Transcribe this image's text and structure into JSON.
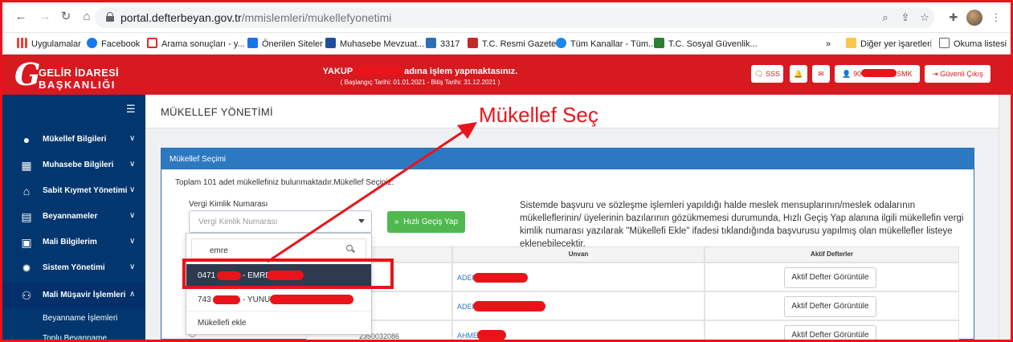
{
  "browser": {
    "url_host": "portal.defterbeyan.gov.tr",
    "url_path": "/mmislemleri/mukellefyonetimi",
    "bookmarks": [
      {
        "label": "Uygulamalar",
        "color": "#ea4335"
      },
      {
        "label": "Facebook",
        "color": "#1877f2"
      },
      {
        "label": "Arama sonuçları - y...",
        "color": "#d93025"
      },
      {
        "label": "Önerilen Siteler",
        "color": "#1a73e8"
      },
      {
        "label": "Muhasebe Mevzuat...",
        "color": "#1f4e9d"
      },
      {
        "label": "3317",
        "color": "#2f6db5"
      },
      {
        "label": "T.C. Resmi Gazete",
        "color": "#c62828"
      },
      {
        "label": "Tüm Kanallar - Tüm...",
        "color": "#1e88e5"
      },
      {
        "label": "T.C. Sosyal Güvenlik...",
        "color": "#2e7d32"
      }
    ],
    "more_label": "»",
    "other_bookmarks": "Diğer yer işaretleri",
    "reading_list": "Okuma listesi"
  },
  "header": {
    "logo_line1": "GELİR İDARESİ",
    "logo_line2": "BAŞKANLIĞI",
    "user_prefix": "YAKUP",
    "user_suffix": "adına işlem yapmaktasınız.",
    "period": "( Başlangıç Tarihi: 01.01.2021 - Bitiş Tarihi: 31.12.2021 )",
    "sss_label": "SSS",
    "user_id_prefix": "90",
    "user_id_suffix": "SMK",
    "logout_label": "Güvenli Çıkış"
  },
  "sidebar": {
    "items": [
      {
        "label": "Mükellef Bilgileri",
        "icon": "user-icon"
      },
      {
        "label": "Muhasebe Bilgileri",
        "icon": "calculator-icon"
      },
      {
        "label": "Sabit Kıymet Yönetimi",
        "icon": "home-icon"
      },
      {
        "label": "Beyannameler",
        "icon": "document-icon"
      },
      {
        "label": "Mali Bilgilerim",
        "icon": "briefcase-icon"
      },
      {
        "label": "Sistem Yönetimi",
        "icon": "gear-icon"
      },
      {
        "label": "Mali Müşavir İşlemleri",
        "icon": "users-icon"
      }
    ],
    "sub_items": [
      "Beyanname İşlemleri",
      "Toplu Beyanname"
    ]
  },
  "main": {
    "page_title": "MÜKELLEF YÖNETİMİ",
    "panel_title": "Mükellef Seçimi",
    "info_line": "Toplam 101 adet mükellefiniz bulunmaktadır.Mükellef Seçiniz:",
    "vkn_label": "Vergi Kimlik Numarası",
    "vkn_placeholder": "Vergi Kimlik Numarası",
    "quick_button": "Hızlı Geçiş Yap",
    "notice": "Sistemde başvuru ve sözleşme işlemleri yapıldığı halde meslek mensuplarının/meslek odalarının mükelleflerinin/ üyelerinin bazılarının gözükmemesi durumunda, Hızlı Geçiş Yap alanına ilgili mükellefin vergi kimlik numarası yazılarak \"Mükellefi Ekle\" ifadesi tıklandığında başvurusu yapılmış olan mükellefler listeye eklenebilecektir.",
    "table": {
      "headers": [
        "Unvan",
        "Aktif Defterler"
      ],
      "rows": [
        {
          "unvan": "ADEM",
          "button": "Aktif Defter Görüntüle"
        },
        {
          "unvan": "ADEM",
          "button": "Aktif Defter Görüntüle"
        },
        {
          "unvan": "AHMET",
          "button": "Aktif Defter Görüntüle",
          "vkn": "2350032086"
        }
      ]
    }
  },
  "dropdown": {
    "search_value": "emre",
    "options": [
      {
        "prefix": "0471",
        "suffix": "- EMRE"
      },
      {
        "prefix": "743",
        "suffix": "- YUNUS"
      }
    ],
    "add_label": "Mükellefi ekle"
  },
  "annotation": {
    "text": "Mükellef Seç",
    "color": "#e8141a"
  }
}
